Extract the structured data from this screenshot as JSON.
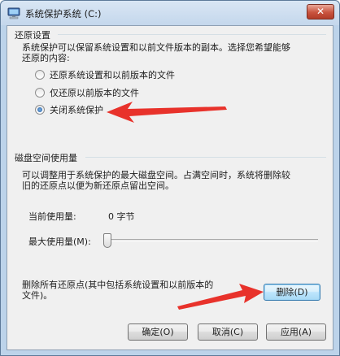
{
  "window": {
    "title": "系统保护系统 (C:)",
    "close_glyph": "✕"
  },
  "restore": {
    "group_title": "还原设置",
    "description_line1": "系统保护可以保留系统设置和以前文件版本的副本。选择您希望能够",
    "description_line2": "还原的内容:",
    "options": [
      {
        "label": "还原系统设置和以前版本的文件",
        "checked": false
      },
      {
        "label": "仅还原以前版本的文件",
        "checked": false
      },
      {
        "label": "关闭系统保护",
        "checked": true
      }
    ]
  },
  "disk": {
    "group_title": "磁盘空间使用量",
    "description_line1": "可以调整用于系统保护的最大磁盘空间。占满空间时，系统将删除较",
    "description_line2": "旧的还原点以便为新还原点留出空间。",
    "current_label": "当前使用量:",
    "current_value": "0 字节",
    "max_label": "最大使用量(M):",
    "max_usage_fraction": 0
  },
  "delete": {
    "text_line1": "删除所有还原点(其中包括系统设置和以前版本的",
    "text_line2": "文件)。",
    "button_label": "删除(D)"
  },
  "footer": {
    "ok_label": "确定(O)",
    "cancel_label": "取消(C)",
    "apply_label": "应用(A)"
  },
  "colors": {
    "annotation_arrow": "#e8322b",
    "focus_border": "#3c7fb1"
  }
}
